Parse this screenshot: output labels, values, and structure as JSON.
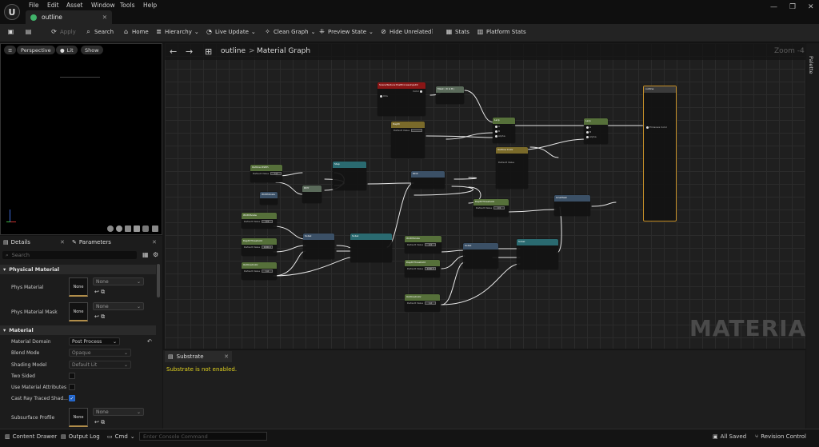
{
  "menu": [
    "File",
    "Edit",
    "Asset",
    "Window",
    "Tools",
    "Help"
  ],
  "tab": {
    "title": "outline"
  },
  "toolbar": {
    "apply": "Apply",
    "search": "Search",
    "home": "Home",
    "hierarchy": "Hierarchy",
    "live_update": "Live Update",
    "clean_graph": "Clean Graph",
    "preview_state": "Preview State",
    "hide_unrelated": "Hide Unrelated",
    "stats": "Stats",
    "platform_stats": "Platform Stats"
  },
  "viewport": {
    "perspective": "Perspective",
    "lit": "Lit",
    "show": "Show"
  },
  "details": {
    "tab_details": "Details",
    "tab_parameters": "Parameters",
    "search_placeholder": "Search",
    "cat_physical": "Physical Material",
    "cat_material": "Material",
    "phys_material": "Phys Material",
    "phys_material_mask": "Phys Material Mask",
    "none": "None",
    "material_domain": "Material Domain",
    "material_domain_value": "Post Process",
    "blend_mode": "Blend Mode",
    "blend_mode_value": "Opaque",
    "shading_model": "Shading Model",
    "shading_model_value": "Default Lit",
    "two_sided": "Two Sided",
    "use_material_attributes": "Use Material Attributes",
    "cast_ray_traced": "Cast Ray Traced Shad...",
    "subsurface_profile": "Subsurface Profile"
  },
  "graph": {
    "breadcrumb_root": "outline",
    "breadcrumb_sep": ">",
    "breadcrumb_leaf": "Material Graph",
    "zoom": "Zoom -4",
    "watermark": "MATERIAL"
  },
  "nodes": {
    "scene_texture": "SceneTexture:PostProcessInput0",
    "mask": "Mask ( R G B )",
    "lerp": "Lerp",
    "output": "outline",
    "outline_color": "Outline Color",
    "depth": "Depth",
    "outline_width": "Outline Width",
    "ddx": "DDX",
    "ddy": "DDY",
    "sobel": "Sobel",
    "step": "Step",
    "color_param": "OutlineColor",
    "width_param": "WidthScale",
    "thresh": "DepthThreshold",
    "line_mask": "LineMask",
    "default_value": "Default Value",
    "alpha": "Alpha",
    "a": "A",
    "b": "B",
    "color": "Color",
    "uvs": "UVs",
    "result": "Result",
    "emissive": "Emissive Color",
    "dv_1": "1.0",
    "dv_05": "0.5",
    "dv_1000": "1000.0",
    "dv_0": "0.0"
  },
  "substrate": {
    "tab": "Substrate",
    "message": "Substrate is not enabled."
  },
  "rail": {
    "palette": "Palette"
  },
  "bottom": {
    "content_drawer": "Content Drawer",
    "output_log": "Output Log",
    "cmd": "Cmd",
    "console_placeholder": "Enter Console Command",
    "all_saved": "All Saved",
    "revision_control": "Revision Control"
  }
}
